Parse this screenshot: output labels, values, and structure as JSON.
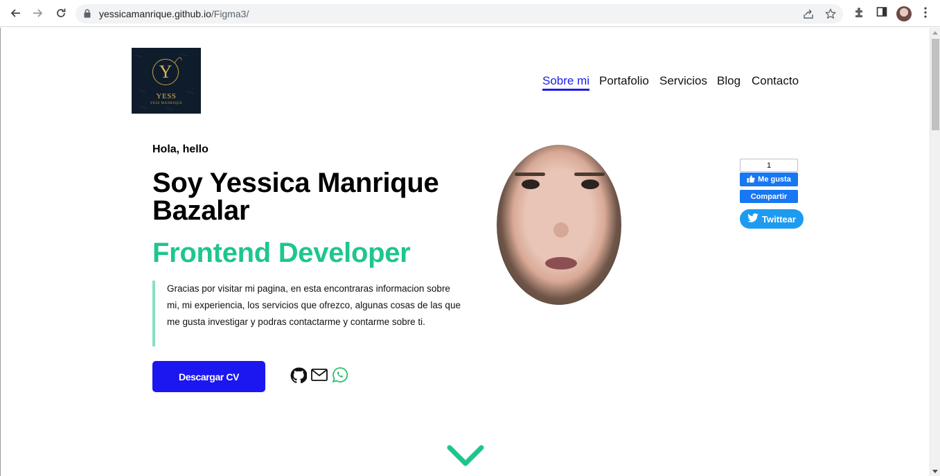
{
  "browser": {
    "url_host": "yessicamanrique.github.io",
    "url_path": "/Figma3/"
  },
  "logo": {
    "letter": "Y",
    "name": "YESS",
    "tagline": "YESS MANRIQUE"
  },
  "nav": {
    "items": [
      {
        "label": "Sobre mi",
        "active": true
      },
      {
        "label": "Portafolio",
        "active": false
      },
      {
        "label": "Servicios",
        "active": false
      },
      {
        "label": "Blog",
        "active": false
      },
      {
        "label": "Contacto",
        "active": false
      }
    ]
  },
  "hero": {
    "greeting": "Hola, hello",
    "name_heading": "Soy Yessica Manrique Bazalar",
    "role": "Frontend Developer",
    "intro": "Gracias por visitar mi pagina, en esta encontraras informacion sobre mi, mi experiencia, los servicios que ofrezco, algunas cosas de las que me gusta investigar y podras contactarme y contarme sobre ti.",
    "cv_button": "Descargar CV",
    "social_icons": [
      "github-icon",
      "mail-icon",
      "whatsapp-icon"
    ]
  },
  "share": {
    "like_count": "1",
    "like_label": "Me gusta",
    "share_label": "Compartir",
    "tweet_label": "Twittear"
  },
  "colors": {
    "accent_blue": "#1c17f0",
    "accent_green": "#1ec68c",
    "quote_border": "#86e0c0",
    "facebook": "#1877f2",
    "twitter": "#1d9bf0"
  }
}
